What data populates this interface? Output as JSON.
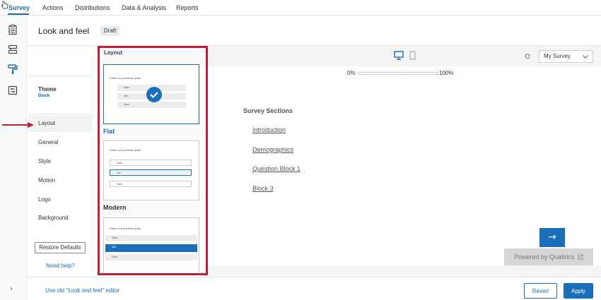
{
  "top_nav": {
    "tabs": [
      {
        "label": "Survey",
        "active": true
      },
      {
        "label": "Actions"
      },
      {
        "label": "Distributions"
      },
      {
        "label": "Data & Analysis"
      },
      {
        "label": "Reports"
      }
    ]
  },
  "rail": {
    "icons": [
      "clipboard-icon",
      "survey-flow-icon",
      "paint-roller-icon",
      "survey-options-icon"
    ],
    "active_icon": "paint-roller-icon"
  },
  "header": {
    "title": "Look and feel",
    "badge": "Draft"
  },
  "settings": {
    "theme_label": "Theme",
    "theme_value": "Blank",
    "items": [
      "Layout",
      "General",
      "Style",
      "Motion",
      "Logo",
      "Background"
    ],
    "active_item": "Layout",
    "restore_label": "Restore Defaults",
    "help_label": "Need help?"
  },
  "layout_panel": {
    "title": "Layout",
    "options": [
      {
        "name": "Flat",
        "selected": true,
        "question": "Etiam non pulvinar quam",
        "choices": [
          "Nulla",
          "Nec",
          "Diam"
        ]
      },
      {
        "name": "Modern",
        "question": "Etiam non pulvinar quam",
        "choices": [
          "Nulla",
          "Nec",
          "Diam"
        ]
      },
      {
        "name": "",
        "question": "Etiam non pulvinar quam",
        "choices": [
          "Nulla",
          "Nec",
          "Diam"
        ]
      }
    ]
  },
  "preview": {
    "survey_select": "My Survey",
    "progress_start": "0%",
    "progress_end": "100%",
    "progress_fraction": 0.0,
    "sections_title": "Survey Sections",
    "sections": [
      "Introduction",
      "Demographics",
      "Question Block 1",
      "Block 3"
    ],
    "next_label": "→",
    "powered_by": "Powered by Qualtrics"
  },
  "bottom": {
    "old_editor_label": "Use old \"Look and feel\" editor",
    "revert_label": "Revert",
    "apply_label": "Apply"
  },
  "colors": {
    "accent": "#1a6fba",
    "highlight_border": "#b82233"
  }
}
